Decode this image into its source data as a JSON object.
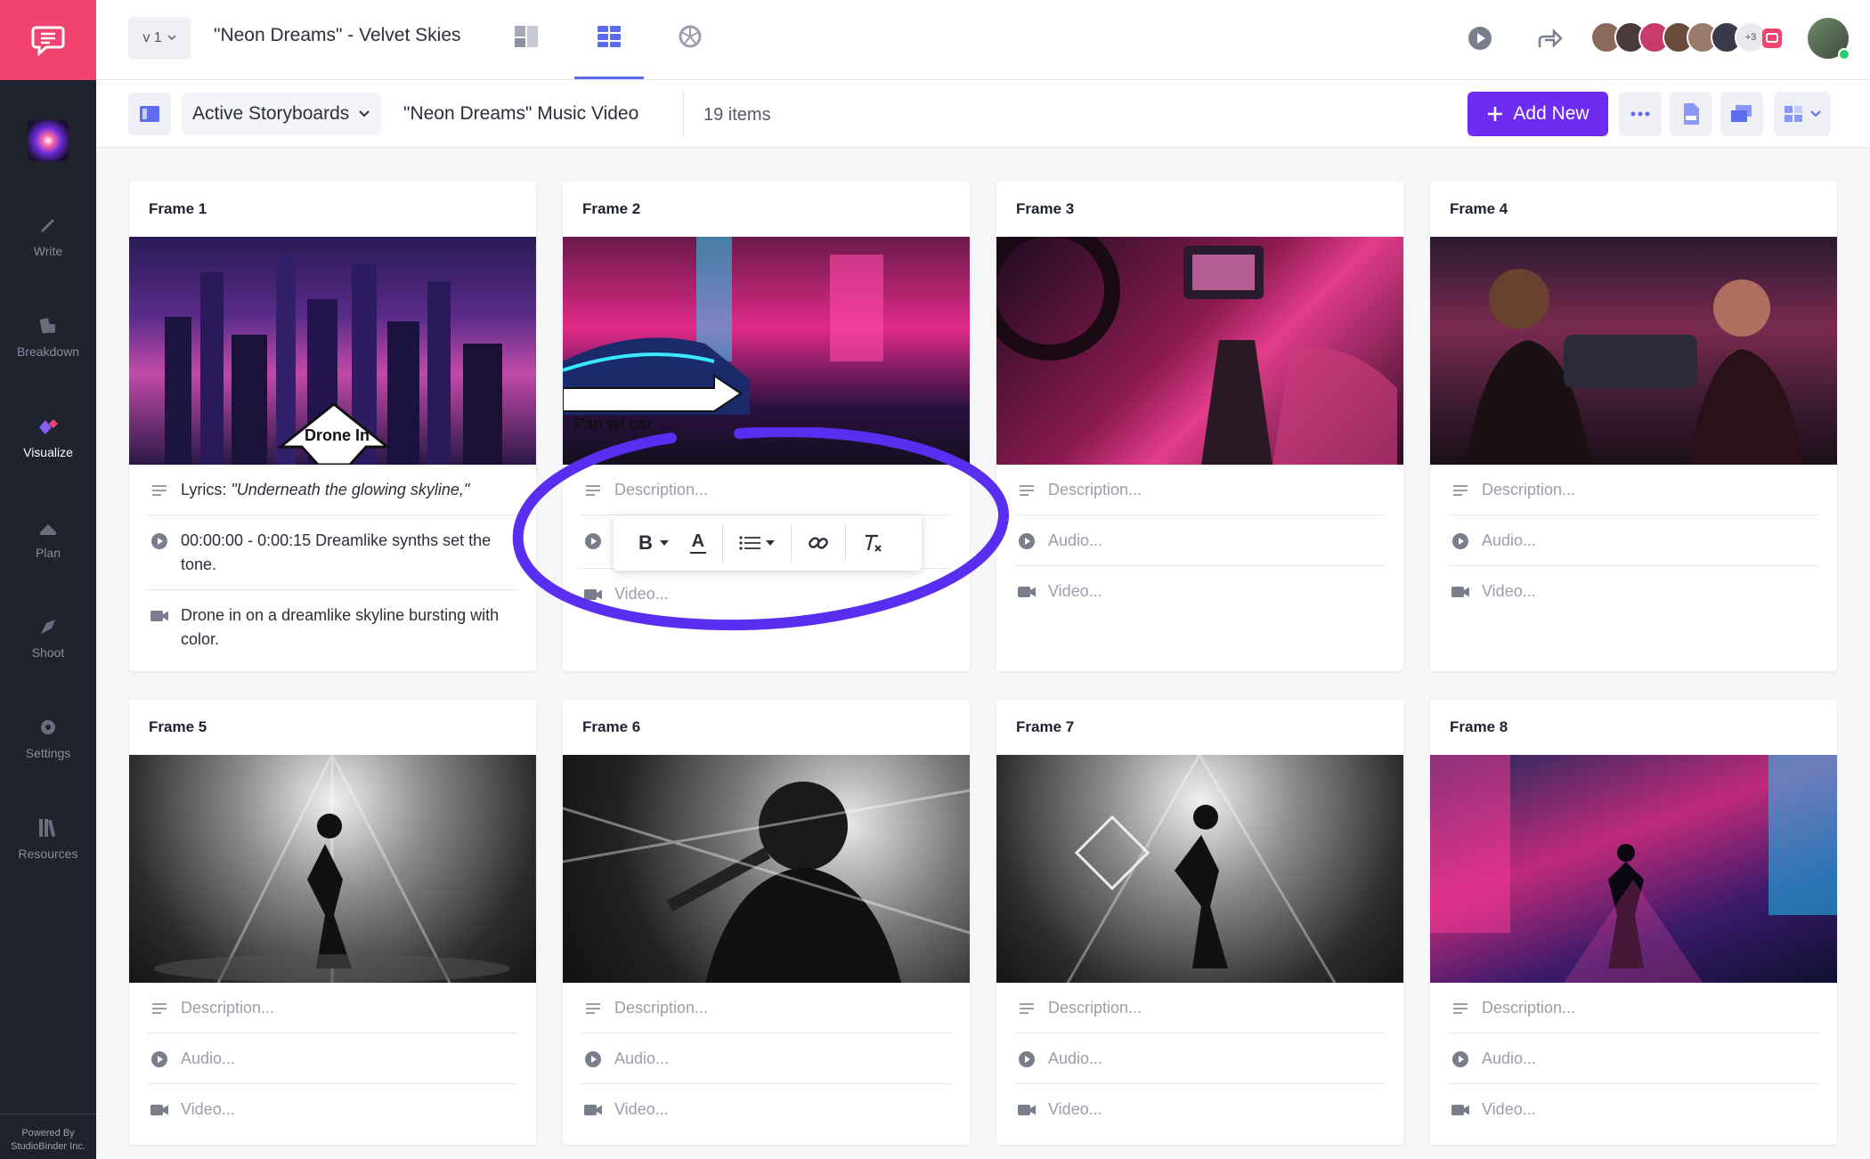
{
  "sidebar": {
    "items": [
      {
        "label": "Write",
        "icon": "pencil-icon"
      },
      {
        "label": "Breakdown",
        "icon": "breakdown-icon"
      },
      {
        "label": "Visualize",
        "icon": "visualize-icon"
      },
      {
        "label": "Plan",
        "icon": "plan-icon"
      },
      {
        "label": "Shoot",
        "icon": "shoot-icon"
      },
      {
        "label": "Settings",
        "icon": "gear-icon"
      },
      {
        "label": "Resources",
        "icon": "library-icon"
      }
    ],
    "powered_line1": "Powered By",
    "powered_line2": "StudioBinder Inc."
  },
  "topbar": {
    "version": "v 1",
    "project_title": "\"Neon Dreams\" - Velvet Skies",
    "avatars_more": "+3"
  },
  "subbar": {
    "dropdown_label": "Active Storyboards",
    "storyboard_title": "\"Neon Dreams\" Music Video",
    "item_count": "19 items",
    "add_new_label": "Add New"
  },
  "colors": {
    "brand_pink": "#f0436d",
    "accent_purple": "#6d2cf0",
    "sidebar_bg": "#20222d",
    "annotation": "#5a2ef0"
  },
  "frames": [
    {
      "title": "Frame 1",
      "overlay": "Drone In",
      "lyrics_label": "Lyrics:",
      "lyrics": "\"Underneath the glowing skyline,\"",
      "audio": "00:00:00 - 0:00:15 Dreamlike synths set the tone.",
      "video": "Drone in on a dreamlike skyline bursting with color."
    },
    {
      "title": "Frame 2",
      "overlay": "Pan w/ car",
      "description": "Description...",
      "video": "Video..."
    },
    {
      "title": "Frame 3",
      "description": "Description...",
      "audio": "Audio...",
      "video": "Video..."
    },
    {
      "title": "Frame 4",
      "description": "Description...",
      "audio": "Audio...",
      "video": "Video..."
    },
    {
      "title": "Frame 5",
      "description": "Description...",
      "audio": "Audio...",
      "video": "Video..."
    },
    {
      "title": "Frame 6",
      "description": "Description...",
      "audio": "Audio...",
      "video": "Video..."
    },
    {
      "title": "Frame 7",
      "description": "Description...",
      "audio": "Audio...",
      "video": "Video..."
    },
    {
      "title": "Frame 8",
      "description": "Description...",
      "audio": "Audio...",
      "video": "Video..."
    }
  ],
  "rte_toolbar": {
    "bold": "B",
    "font_color": "A"
  }
}
